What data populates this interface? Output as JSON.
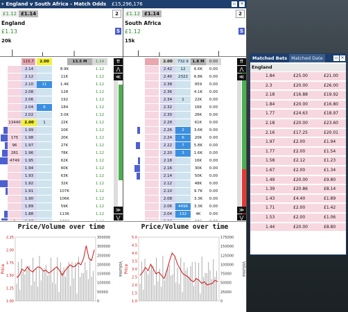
{
  "window": {
    "title": "England v South Africa - Match Odds",
    "matched": "£15,296,176",
    "count": "2"
  },
  "left": {
    "lay_price": "£1.12",
    "back_price": "£1.14",
    "runner": "England",
    "runner_price": "£1.13",
    "s_label": "S",
    "vol_label": "20k",
    "header": {
      "c1": "115.7",
      "c2": "2.00",
      "c4": "13.5 M",
      "c5": "1.14"
    },
    "rows": [
      {
        "a": "",
        "p": "2.14",
        "b": "",
        "v": "8.9K",
        "r": "1.12",
        "blue": false
      },
      {
        "a": "",
        "p": "2.12",
        "b": "",
        "v": "11K",
        "r": "1.12",
        "blue": false
      },
      {
        "a": "",
        "p": "2.10",
        "b": "11",
        "v": "1.4K",
        "r": "1.12",
        "blue": true
      },
      {
        "a": "",
        "p": "2.08",
        "b": "",
        "v": "128",
        "r": "1.12",
        "blue": false
      },
      {
        "a": "",
        "p": "2.06",
        "b": "",
        "v": "192",
        "r": "1.12",
        "blue": false
      },
      {
        "a": "",
        "p": "2.04",
        "b": "6",
        "v": "184",
        "r": "1.12",
        "blue": true
      },
      {
        "a": "",
        "p": "2.02",
        "b": "",
        "v": "3.0K",
        "r": "1.12",
        "blue": false
      },
      {
        "a": "13440",
        "p": "2.00",
        "b": "1",
        "v": "22K",
        "r": "1.12",
        "blue": false,
        "yel": true
      },
      {
        "a": "",
        "p": "1.99",
        "b": "",
        "v": "10K",
        "r": "1.12",
        "blue": false
      },
      {
        "a": "175",
        "p": "1.98",
        "b": "",
        "v": "20K",
        "r": "1.12",
        "blue": false
      },
      {
        "a": "96",
        "p": "1.97",
        "b": "",
        "v": "27K",
        "r": "1.12",
        "blue": false
      },
      {
        "a": "281",
        "p": "1.96",
        "b": "",
        "v": "78K",
        "r": "1.12",
        "blue": false
      },
      {
        "a": "4749",
        "p": "1.95",
        "b": "",
        "v": "62K",
        "r": "1.12",
        "blue": false
      },
      {
        "a": "",
        "p": "1.94",
        "b": "",
        "v": "60K",
        "r": "1.12",
        "blue": false
      },
      {
        "a": "",
        "p": "1.93",
        "b": "",
        "v": "63K",
        "r": "1.12",
        "blue": false
      },
      {
        "a": "",
        "p": "1.92",
        "b": "",
        "v": "32K",
        "r": "1.12",
        "blue": false
      },
      {
        "a": "",
        "p": "1.91",
        "b": "",
        "v": "107K",
        "r": "1.12",
        "blue": false
      },
      {
        "a": "",
        "p": "1.90",
        "b": "",
        "v": "106K",
        "r": "1.12",
        "blue": false
      },
      {
        "a": "",
        "p": "1.89",
        "b": "",
        "v": "59K",
        "r": "1.12",
        "blue": false
      },
      {
        "a": "",
        "p": "1.88",
        "b": "",
        "v": "113K",
        "r": "1.12",
        "blue": false
      },
      {
        "a": "1",
        "p": "1.87",
        "b": "",
        "v": "130K",
        "r": "1.12",
        "blue": false
      },
      {
        "a": "",
        "p": "1.86",
        "b": "",
        "v": "258K",
        "r": "1.12",
        "blue": false
      }
    ]
  },
  "right": {
    "lay_price": "£1.12",
    "back_price": "£1.14",
    "runner": "South Africa",
    "runner_price": "£1.12",
    "s_label": "S",
    "vol_label": "15k",
    "header": {
      "c4": "2.00",
      "c5": "732.9",
      "c6": "1.8 M",
      "c7": "0.00"
    },
    "rows": [
      {
        "p": "2.42",
        "b": "12",
        "v": "6.6K",
        "r": "0.00",
        "blue": false
      },
      {
        "p": "2.40",
        "b": "2322",
        "v": "6.8K",
        "r": "0.00",
        "blue": false
      },
      {
        "p": "2.38",
        "b": "",
        "v": "959",
        "r": "0.00",
        "blue": false
      },
      {
        "p": "2.36",
        "b": "",
        "v": "4.1K",
        "r": "0.00",
        "blue": false
      },
      {
        "p": "2.34",
        "b": "1",
        "v": "22K",
        "r": "0.00",
        "blue": false
      },
      {
        "p": "2.32",
        "b": "",
        "v": "16K",
        "r": "0.00",
        "blue": false
      },
      {
        "p": "2.30",
        "b": "",
        "v": "26K",
        "r": "0.00",
        "blue": false
      },
      {
        "p": "2.28",
        "b": "",
        "v": "61K",
        "r": "0.00",
        "blue": false
      },
      {
        "p": "2.26",
        "b": "2",
        "v": "3.6K",
        "r": "0.00",
        "blue": true
      },
      {
        "p": "2.24",
        "b": "6",
        "v": "20K",
        "r": "0.00",
        "blue": true
      },
      {
        "p": "2.22",
        "b": "7",
        "v": "5.8K",
        "r": "0.00",
        "blue": true
      },
      {
        "p": "2.20",
        "b": "3",
        "v": "1.6K",
        "r": "0.00",
        "blue": true
      },
      {
        "p": "2.18",
        "b": "",
        "v": "16K",
        "r": "0.00",
        "blue": false
      },
      {
        "p": "2.16",
        "b": "",
        "v": "30K",
        "r": "0.00",
        "blue": false
      },
      {
        "p": "2.14",
        "b": "",
        "v": "50K",
        "r": "0.00",
        "blue": false
      },
      {
        "p": "2.12",
        "b": "",
        "v": "48K",
        "r": "0.00",
        "blue": false
      },
      {
        "p": "2.10",
        "b": "",
        "v": "9.7K",
        "r": "0.00",
        "blue": false
      },
      {
        "p": "2.08",
        "b": "",
        "v": "3.3K",
        "r": "0.00",
        "blue": false
      },
      {
        "p": "2.06",
        "b": "4496",
        "v": "3.3K",
        "r": "0.00",
        "blue": true
      },
      {
        "p": "2.04",
        "b": "132",
        "v": "4K",
        "r": "0.00",
        "blue": true
      },
      {
        "p": "2.02",
        "b": "",
        "v": "30K",
        "r": "0.00",
        "blue": false
      },
      {
        "p": "2.00",
        "b": "13440",
        "v": "83K",
        "r": "0.00",
        "blue": true
      }
    ]
  },
  "chart_data": [
    {
      "type": "line",
      "title": "Price/Volume over time",
      "ylabel": "Price",
      "y2label": "Volume",
      "ylim": [
        1.0,
        2.5
      ],
      "y2lim": [
        0,
        350000
      ],
      "yticks": [
        "2.25",
        "2.00",
        "1.75",
        "1.50",
        "1.25",
        "1.00"
      ],
      "y2ticks": [
        "350000",
        "300000",
        "250000",
        "200000",
        "150000",
        "100000",
        "50000",
        "0"
      ],
      "series": [
        {
          "values": [
            1.55,
            1.6,
            1.75,
            1.7,
            1.8,
            1.72,
            1.68,
            1.75,
            1.8,
            1.78,
            1.7,
            1.72,
            1.65,
            1.7,
            1.75,
            1.8,
            1.72,
            1.6,
            1.7,
            1.78,
            1.85,
            1.8,
            1.82,
            1.9,
            1.85,
            2.0,
            2.3,
            2.0,
            1.95,
            2.2
          ]
        }
      ]
    },
    {
      "type": "line",
      "title": "Price/Volume over time",
      "ylabel": "Price",
      "y2label": "Volume",
      "ylim": [
        1.0,
        5.0
      ],
      "y2lim": [
        0,
        175000
      ],
      "yticks": [
        "5.0",
        "4.5",
        "4.0",
        "3.5",
        "3.0",
        "2.5",
        "2.0",
        "1.5",
        "1.0"
      ],
      "y2ticks": [
        "175000",
        "150000",
        "125000",
        "100000",
        "75000",
        "50000",
        "25000",
        "0"
      ],
      "series": [
        {
          "values": [
            2.6,
            2.8,
            3.1,
            2.9,
            3.3,
            3.0,
            2.7,
            2.8,
            2.6,
            2.4,
            2.9,
            3.5,
            4.0,
            3.8,
            3.3,
            3.0,
            2.7,
            2.6,
            2.5,
            2.3,
            2.2,
            2.4,
            2.3,
            2.1,
            2.2,
            2.0,
            2.05,
            2.1,
            2.3,
            2.2
          ]
        }
      ]
    }
  ],
  "matched_bets": {
    "tab_active": "Matched Bets",
    "tab_inactive": "Matched Date",
    "team": "England",
    "rows": [
      [
        "1.84",
        "£25.00",
        "£21.00"
      ],
      [
        "2.3",
        "£20.00",
        "£26.00"
      ],
      [
        "2.18",
        "£16.88",
        "£19.92"
      ],
      [
        "1.84",
        "£20.00",
        "£16.80"
      ],
      [
        "1.77",
        "£24.63",
        "£18.97"
      ],
      [
        "2.18",
        "£20.00",
        "£23.60"
      ],
      [
        "2.16",
        "£17.25",
        "£20.01"
      ],
      [
        "1.97",
        "£2.00",
        "£1.94"
      ],
      [
        "1.77",
        "£2.00",
        "£1.54"
      ],
      [
        "1.58",
        "£2.12",
        "£1.23"
      ],
      [
        "1.67",
        "£2.00",
        "£1.34"
      ],
      [
        "1.49",
        "£20.00",
        "£9.80"
      ],
      [
        "1.39",
        "£20.86",
        "£8.14"
      ],
      [
        "1.43",
        "£4.40",
        "£1.89"
      ],
      [
        "1.71",
        "£2.00",
        "£1.42"
      ],
      [
        "1.53",
        "£2.00",
        "£1.06"
      ],
      [
        "1.44",
        "£20.00",
        "£8.80"
      ]
    ]
  }
}
